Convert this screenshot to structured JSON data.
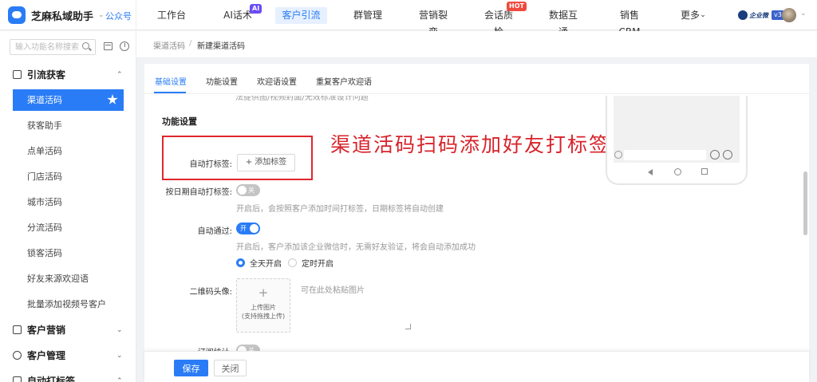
{
  "topbar": {
    "brand_name": "芝麻私域助手",
    "brand_caret": "⌄",
    "account_type": "公众号",
    "nav": [
      {
        "label": "工作台"
      },
      {
        "label": "AI话术",
        "badge": "AI"
      },
      {
        "label": "客户引流",
        "active": true
      },
      {
        "label": "群管理"
      },
      {
        "label": "营销裂变"
      },
      {
        "label": "会话质检",
        "badge": "HOT"
      },
      {
        "label": "数据互通"
      },
      {
        "label": "销售CRM"
      },
      {
        "label": "更多"
      }
    ],
    "more_caret": "⌄",
    "enterprise_label": "企业微",
    "enterprise_version": "v3",
    "user_caret": "⌄"
  },
  "sidebar": {
    "search_placeholder": "输入功能名称搜索",
    "groups": [
      {
        "title": "引流获客",
        "caret": "⌃"
      },
      {
        "title": "客户营销",
        "caret": "⌄"
      },
      {
        "title": "客户管理",
        "caret": "⌄"
      },
      {
        "title": "自动打标签",
        "caret": "⌃"
      }
    ],
    "items": [
      {
        "label": "渠道活码",
        "active": true
      },
      {
        "label": "获客助手"
      },
      {
        "label": "点单活码"
      },
      {
        "label": "门店活码"
      },
      {
        "label": "城市活码"
      },
      {
        "label": "分流活码"
      },
      {
        "label": "锁客活码"
      },
      {
        "label": "好友来源欢迎语"
      },
      {
        "label": "批量添加视频号客户"
      }
    ]
  },
  "breadcrumb": {
    "parent": "渠道活码",
    "separator": "/",
    "current": "新建渠道活码"
  },
  "tabs": [
    {
      "label": "基础设置",
      "active": true
    },
    {
      "label": "功能设置"
    },
    {
      "label": "欢迎语设置"
    },
    {
      "label": "重复客户欢迎语"
    }
  ],
  "form": {
    "cut_hint": "法提供图/视频封面/无效标准设计问题",
    "section_title": "功能设置",
    "auto_tag_label": "自动打标签:",
    "add_tag_button": "+ 添加标签",
    "annotation": "渠道活码扫码添加好友打标签",
    "date_tag_label": "按日期自动打标签:",
    "date_tag_switch": "关",
    "date_tag_help": "开启后，会按照客户添加时间打标签，日期标签将自动创建",
    "auto_pass_label": "自动通过:",
    "auto_pass_switch": "开",
    "auto_pass_help": "开启后，客户添加该企业微信时，无需好友验证，将会自动添加成功",
    "radio_all_day": "全天开启",
    "radio_scheduled": "定时开启",
    "avatar_label": "二维码头像:",
    "upload_plus": "+",
    "upload_line1": "上传图片",
    "upload_line2": "(支持拖拽上传)",
    "paste_hint": "可在此处粘贴图片",
    "subscribe_label": "订阅统计:",
    "subscribe_switch": "关"
  },
  "footer": {
    "save": "保存",
    "close": "关闭"
  },
  "colors": {
    "accent": "#2a7cf6",
    "annotation_red": "#d7232b",
    "switch_off": "#c4c4c4"
  }
}
